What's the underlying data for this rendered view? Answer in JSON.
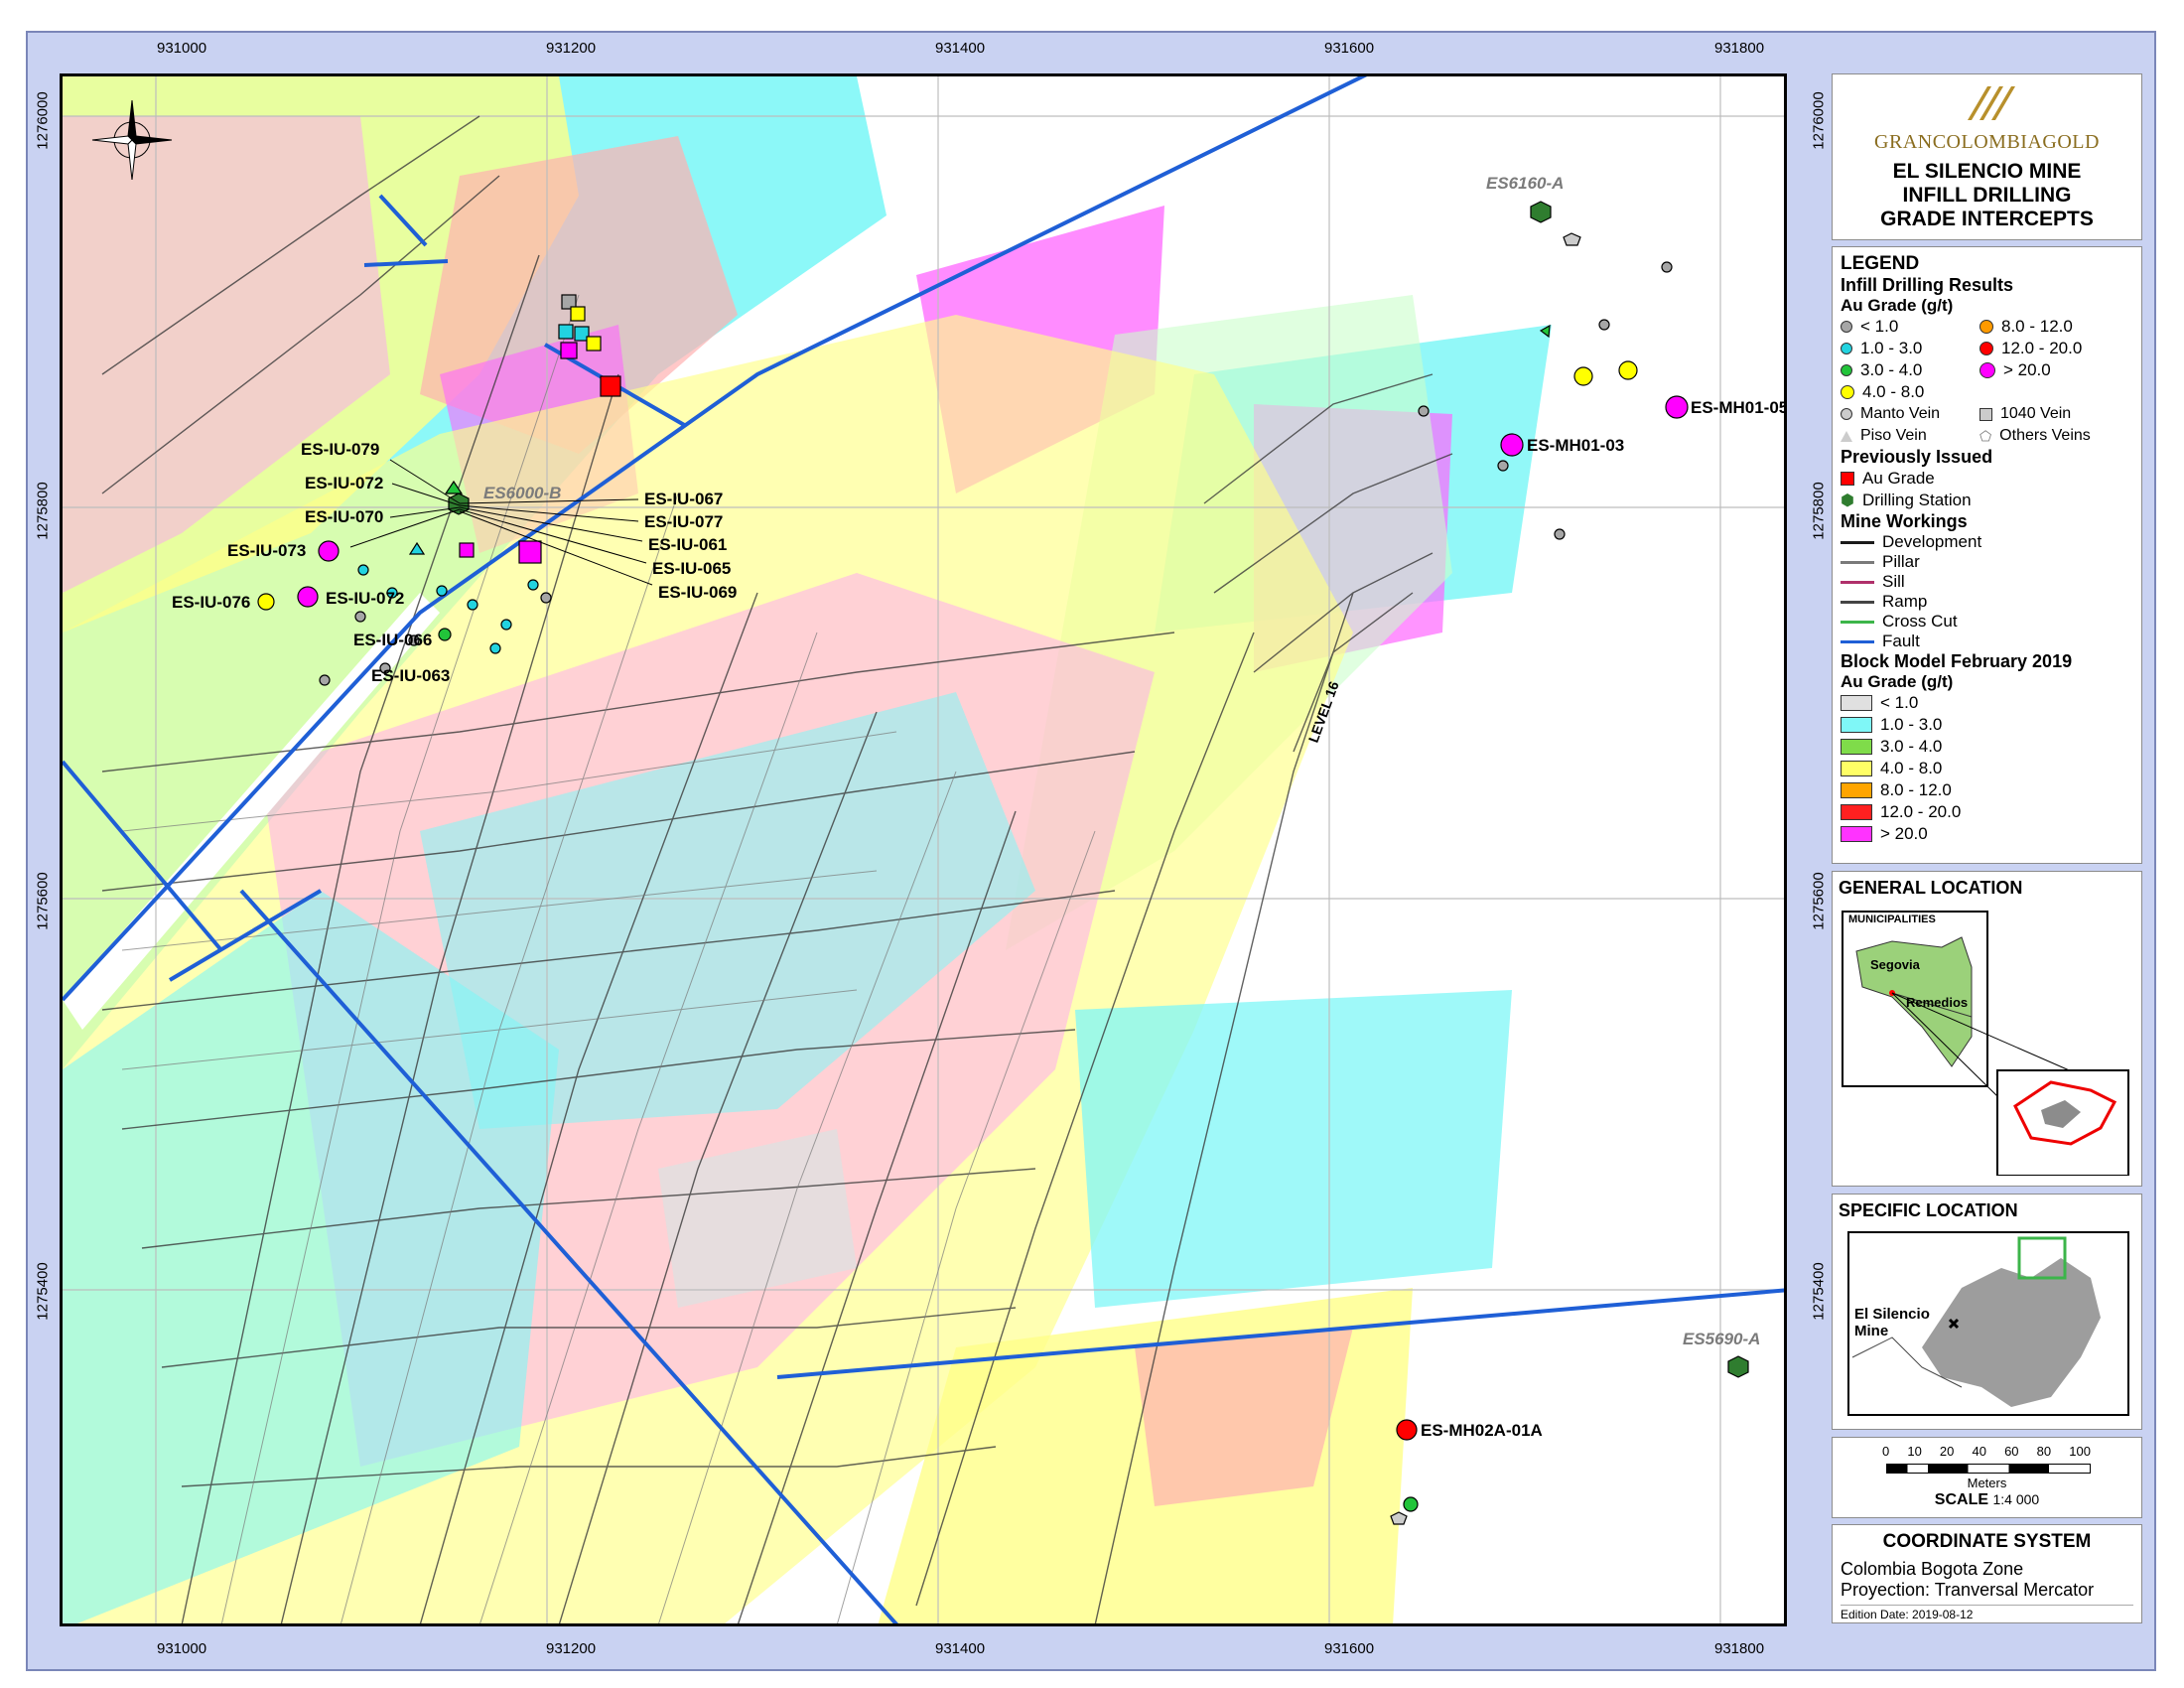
{
  "axes": {
    "x_ticks": [
      "931000",
      "931200",
      "931400",
      "931600",
      "931800"
    ],
    "y_ticks": [
      "1276000",
      "1275800",
      "1275600",
      "1275400"
    ]
  },
  "title_block": {
    "logo": "GRANCOLOMBIAGOLD",
    "title_line1": "EL SILENCIO MINE",
    "title_line2": "INFILL DRILLING",
    "title_line3": "GRADE INTERCEPTS"
  },
  "legend": {
    "heading": "LEGEND",
    "infill_heading": "Infill Drilling Results",
    "au_grade": "Au Grade (g/t)",
    "grades": [
      {
        "label": "< 1.0",
        "color": "#a6a6a6"
      },
      {
        "label": "1.0 - 3.0",
        "color": "#22d3e0"
      },
      {
        "label": "3.0 - 4.0",
        "color": "#22c43a"
      },
      {
        "label": "4.0 - 8.0",
        "color": "#ffff00"
      },
      {
        "label": "8.0 - 12.0",
        "color": "#ff9a00"
      },
      {
        "label": "12.0 - 20.0",
        "color": "#ff0000"
      },
      {
        "label": "> 20.0",
        "color": "#ff00ff"
      }
    ],
    "vein_types": [
      "Manto Vein",
      "1040 Vein",
      "Piso Vein",
      "Others Veins"
    ],
    "prev_heading": "Previously Issued",
    "prev_items": [
      "Au Grade",
      "Drilling Station"
    ],
    "workings_heading": "Mine Workings",
    "workings": [
      {
        "label": "Development",
        "color": "#1a1a1a"
      },
      {
        "label": "Pillar",
        "color": "#7a7a7a"
      },
      {
        "label": "Sill",
        "color": "#b0306a"
      },
      {
        "label": "Ramp",
        "color": "#444444"
      },
      {
        "label": "Cross Cut",
        "color": "#3cb54a"
      },
      {
        "label": "Fault",
        "color": "#1f5fd6"
      }
    ],
    "block_heading": "Block Model February 2019",
    "block_sub": "Au Grade (g/t)",
    "block_grades": [
      {
        "label": "< 1.0",
        "color": "#e0e0e0"
      },
      {
        "label": "1.0 - 3.0",
        "color": "#7ff7f7"
      },
      {
        "label": "3.0 - 4.0",
        "color": "#7fdc4a"
      },
      {
        "label": "4.0 - 8.0",
        "color": "#ffff66"
      },
      {
        "label": "8.0 - 12.0",
        "color": "#ffa500"
      },
      {
        "label": "12.0 - 20.0",
        "color": "#ff2020"
      },
      {
        "label": "> 20.0",
        "color": "#ff33ff"
      }
    ]
  },
  "general_location": {
    "heading": "GENERAL LOCATION",
    "municipalities": "MUNICIPALITIES",
    "segovia": "Segovia",
    "remedios": "Remedios"
  },
  "specific_location": {
    "heading": "SPECIFIC LOCATION",
    "mine": "El Silencio Mine"
  },
  "scale": {
    "ticks": [
      "0",
      "10",
      "20",
      "40",
      "60",
      "80",
      "100"
    ],
    "units": "Meters",
    "label": "SCALE",
    "ratio": "1:4 000"
  },
  "coordinate_system": {
    "heading": "COORDINATE SYSTEM",
    "zone": "Colombia Bogota Zone",
    "projection": "Proyection: Tranversal Mercator",
    "edition": "Edition Date: 2019-08-12"
  },
  "map_labels": {
    "stations": [
      "ES6160-A",
      "ES6000-B",
      "ES5690-A"
    ],
    "drillholes": [
      "ES-IU-079",
      "ES-IU-072",
      "ES-IU-070",
      "ES-IU-073",
      "ES-IU-076",
      "ES-IU-072",
      "ES-IU-066",
      "ES-IU-063",
      "ES-IU-067",
      "ES-IU-077",
      "ES-IU-061",
      "ES-IU-065",
      "ES-IU-069",
      "ES-MH01-05",
      "ES-MH01-03",
      "ES-MH02A-01A"
    ],
    "level": "LEVEL 16"
  }
}
